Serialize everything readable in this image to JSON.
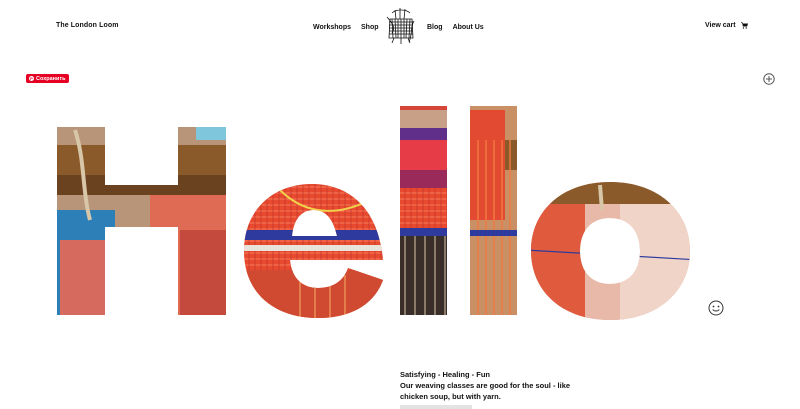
{
  "header": {
    "brand": "The London Loom",
    "nav_left": [
      "Workshops",
      "Shop"
    ],
    "nav_right": [
      "Blog",
      "About Us"
    ],
    "cart_label": "View cart",
    "logo_icon": "weave-logo-icon",
    "cart_icon": "cart-icon"
  },
  "pin_button": {
    "label": "Сохранить",
    "icon": "pinterest-icon",
    "color": "#e60023"
  },
  "hero": {
    "word": "Hello"
  },
  "intro": {
    "tagline": "Satisfying - Healing - Fun",
    "description": "Our weaving classes are good for the soul - like chicken soup, but with yarn."
  },
  "icons": {
    "zoom": "plus-circle-icon",
    "feedback": "smiley-icon"
  }
}
